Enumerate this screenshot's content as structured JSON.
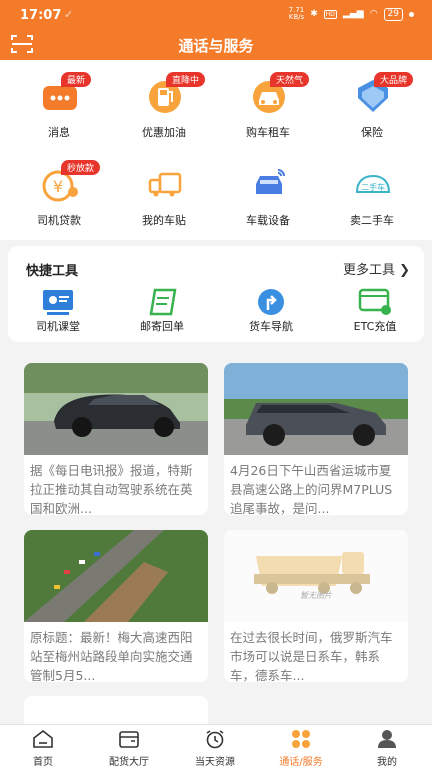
{
  "status_bar": {
    "time": "17:07",
    "speed_top": "7.71",
    "speed_bottom": "KB/s",
    "battery": "29"
  },
  "header": {
    "title": "通话与服务"
  },
  "services": [
    {
      "label": "消息",
      "badge": "最新",
      "icon": "message-icon"
    },
    {
      "label": "优惠加油",
      "badge": "直降中",
      "icon": "fuel-pump-icon"
    },
    {
      "label": "购车租车",
      "badge": "天然气",
      "icon": "car-rental-icon"
    },
    {
      "label": "保险",
      "badge": "大品牌",
      "icon": "insurance-shield-icon"
    },
    {
      "label": "司机贷款",
      "badge": "秒放款",
      "icon": "loan-yuan-icon"
    },
    {
      "label": "我的车贴",
      "badge": "",
      "icon": "truck-sticker-icon"
    },
    {
      "label": "车载设备",
      "badge": "",
      "icon": "car-device-icon"
    },
    {
      "label": "卖二手车",
      "badge": "",
      "icon": "used-car-icon"
    }
  ],
  "tools": {
    "title": "快捷工具",
    "more": "更多工具 ❯",
    "items": [
      {
        "label": "司机课堂",
        "icon": "driver-classroom-icon"
      },
      {
        "label": "邮寄回单",
        "icon": "mail-receipt-icon"
      },
      {
        "label": "货车导航",
        "icon": "truck-navigation-icon"
      },
      {
        "label": "ETC充值",
        "icon": "etc-recharge-icon"
      }
    ]
  },
  "news": [
    {
      "text": "据《每日电讯报》报道，特斯拉正推动其自动驾驶系统在英国和欧洲..."
    },
    {
      "text": "4月26日下午山西省运城市夏县高速公路上的问界M7PLUS追尾事故，是问..."
    },
    {
      "text": "原标题：最新！梅大高速西阳站至梅州站路段单向实施交通管制5月5..."
    },
    {
      "text": "在过去很长时间，俄罗斯汽车市场可以说是日系车，韩系车，德系车...",
      "placeholder": "暂无图片"
    }
  ],
  "tabs": [
    {
      "label": "首页",
      "icon": "home-icon",
      "active": false
    },
    {
      "label": "配货大厅",
      "icon": "cargo-hall-icon",
      "active": false
    },
    {
      "label": "当天资源",
      "icon": "alarm-clock-icon",
      "active": false
    },
    {
      "label": "通话/服务",
      "icon": "service-grid-icon",
      "active": true
    },
    {
      "label": "我的",
      "icon": "profile-icon",
      "active": false
    }
  ],
  "colors": {
    "brand": "#f47b2a",
    "badge": "#e8352b",
    "active_tab": "#f47b2a"
  }
}
